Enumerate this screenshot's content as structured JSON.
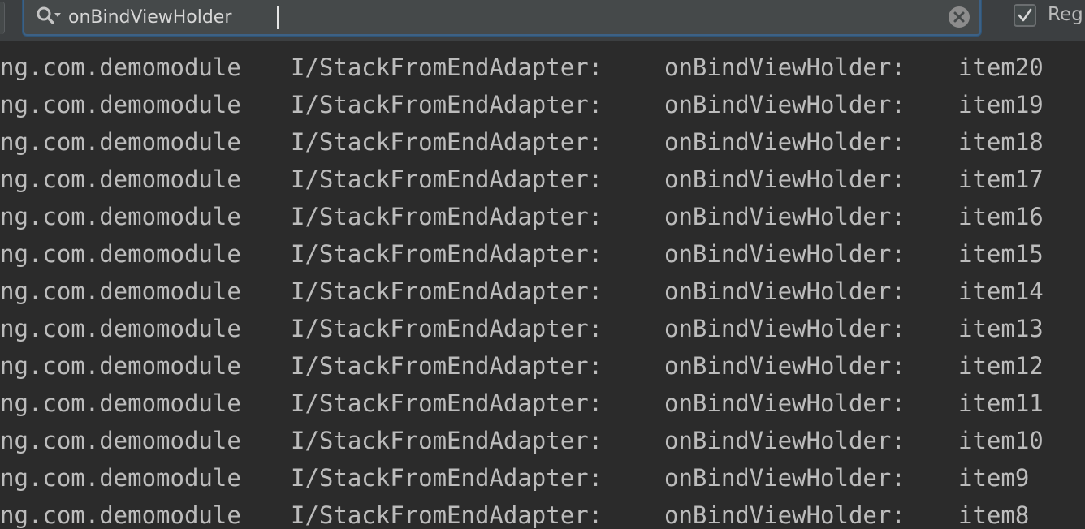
{
  "search": {
    "query": "onBindViewHolder",
    "regex_label": "Reg",
    "regex_checked": true
  },
  "log": {
    "lines": [
      {
        "tag": "ng.com.demomodule",
        "source": "I/StackFromEndAdapter:",
        "method": "onBindViewHolder:",
        "item": "item20"
      },
      {
        "tag": "ng.com.demomodule",
        "source": "I/StackFromEndAdapter:",
        "method": "onBindViewHolder:",
        "item": "item19"
      },
      {
        "tag": "ng.com.demomodule",
        "source": "I/StackFromEndAdapter:",
        "method": "onBindViewHolder:",
        "item": "item18"
      },
      {
        "tag": "ng.com.demomodule",
        "source": "I/StackFromEndAdapter:",
        "method": "onBindViewHolder:",
        "item": "item17"
      },
      {
        "tag": "ng.com.demomodule",
        "source": "I/StackFromEndAdapter:",
        "method": "onBindViewHolder:",
        "item": "item16"
      },
      {
        "tag": "ng.com.demomodule",
        "source": "I/StackFromEndAdapter:",
        "method": "onBindViewHolder:",
        "item": "item15"
      },
      {
        "tag": "ng.com.demomodule",
        "source": "I/StackFromEndAdapter:",
        "method": "onBindViewHolder:",
        "item": "item14"
      },
      {
        "tag": "ng.com.demomodule",
        "source": "I/StackFromEndAdapter:",
        "method": "onBindViewHolder:",
        "item": "item13"
      },
      {
        "tag": "ng.com.demomodule",
        "source": "I/StackFromEndAdapter:",
        "method": "onBindViewHolder:",
        "item": "item12"
      },
      {
        "tag": "ng.com.demomodule",
        "source": "I/StackFromEndAdapter:",
        "method": "onBindViewHolder:",
        "item": "item11"
      },
      {
        "tag": "ng.com.demomodule",
        "source": "I/StackFromEndAdapter:",
        "method": "onBindViewHolder:",
        "item": "item10"
      },
      {
        "tag": "ng.com.demomodule",
        "source": "I/StackFromEndAdapter:",
        "method": "onBindViewHolder:",
        "item": "item9"
      },
      {
        "tag": "ng.com.demomodule",
        "source": "I/StackFromEndAdapter:",
        "method": "onBindViewHolder:",
        "item": "item8"
      }
    ]
  },
  "icons": {
    "search": "search-with-dropdown-icon",
    "clear": "clear-circle-x-icon",
    "checkbox": "checkmark-icon"
  },
  "colors": {
    "background": "#2b2b2b",
    "toolbar": "#3c3f41",
    "search_field": "#45494a",
    "focus_border": "#3d6185",
    "log_text": "#bcbcbc"
  }
}
